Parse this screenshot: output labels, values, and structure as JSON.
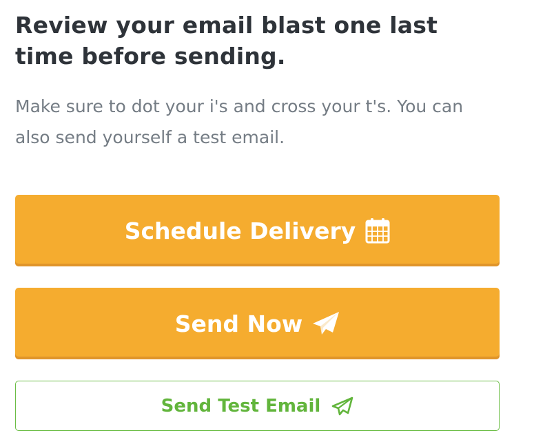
{
  "header": {
    "title": "Review your email blast one last time before sending.",
    "subtitle": "Make sure to dot your i's and cross your t's. You can also send yourself a test email."
  },
  "actions": {
    "schedule": {
      "label": "Schedule Delivery",
      "icon": "calendar-icon"
    },
    "send_now": {
      "label": "Send Now",
      "icon": "paper-plane-icon"
    },
    "send_test": {
      "label": "Send Test Email",
      "icon": "paper-plane-outline-icon"
    }
  },
  "colors": {
    "primary_button": "#f5ac2f",
    "primary_button_shadow": "#e0952a",
    "primary_text": "#ffffff",
    "outline_accent": "#62b53c",
    "title_text": "#2e3339",
    "subtitle_text": "#747c84"
  }
}
